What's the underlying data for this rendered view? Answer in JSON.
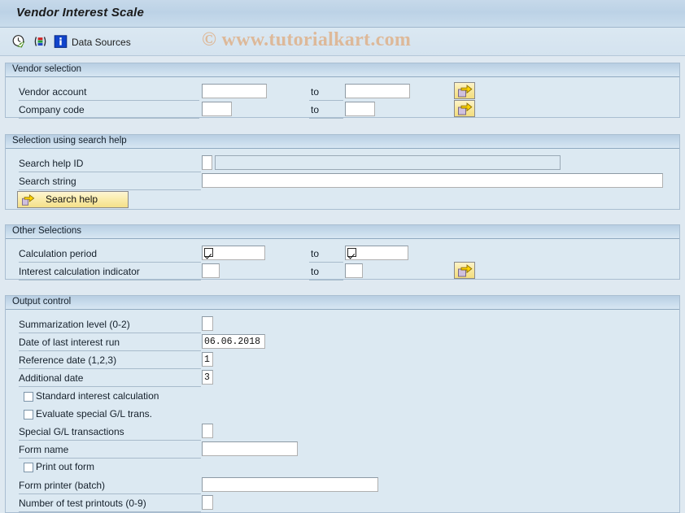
{
  "window": {
    "title": "Vendor Interest Scale"
  },
  "toolbar": {
    "icons": [
      {
        "name": "execute-clock-check-icon",
        "label": "Execute"
      },
      {
        "name": "variant-bars-icon",
        "label": "Get Variant"
      },
      {
        "name": "information-icon",
        "label": "Information"
      }
    ],
    "data_sources_label": "Data Sources"
  },
  "watermark": {
    "text": "© www.tutorialkart.com",
    "color": "#e0a878"
  },
  "common": {
    "to_label": "to",
    "multi_select_title": "Multiple selection"
  },
  "sections": [
    {
      "id": "vendor-selection",
      "title": "Vendor selection",
      "rows": [
        {
          "label": "Vendor account",
          "value": "",
          "to_value": ""
        },
        {
          "label": "Company code",
          "value": "",
          "to_value": ""
        }
      ]
    },
    {
      "id": "selection-using-search-help",
      "title": "Selection using search help",
      "rows": [
        {
          "label": "Search help ID",
          "value": "",
          "readonly_value": ""
        },
        {
          "label": "Search string",
          "value": ""
        }
      ],
      "button": {
        "label": "Search help"
      }
    },
    {
      "id": "other-selections",
      "title": "Other Selections",
      "rows": [
        {
          "label": "Calculation period",
          "value": "",
          "to_value": ""
        },
        {
          "label": "Interest calculation indicator",
          "value": "",
          "to_value": ""
        }
      ]
    },
    {
      "id": "output-control",
      "title": "Output control",
      "rows": [
        {
          "label": "Summarization level (0-2)",
          "value": ""
        },
        {
          "label": "Date of last interest run",
          "value": "06.06.2018"
        },
        {
          "label": "Reference date (1,2,3)",
          "value": "1"
        },
        {
          "label": "Additional date",
          "value": "3"
        },
        {
          "label": "Special G/L transactions",
          "value": ""
        },
        {
          "label": "Form name",
          "value": ""
        },
        {
          "label": "Form printer (batch)",
          "value": ""
        },
        {
          "label": "Number of test printouts (0-9)",
          "value": ""
        }
      ],
      "checkboxes": [
        {
          "label": "Standard interest calculation",
          "checked": false
        },
        {
          "label": "Evaluate special G/L trans.",
          "checked": false
        },
        {
          "label": "Print out form",
          "checked": false
        }
      ]
    }
  ]
}
